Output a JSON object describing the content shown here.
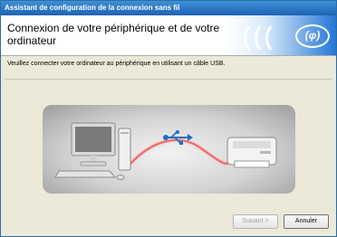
{
  "window": {
    "title": "Assistant de configuration de la connexion sans fil"
  },
  "header": {
    "title": "Connexion de votre périphérique et de votre ordinateur",
    "logo_text": "(φ)"
  },
  "main": {
    "instruction": "Veuillez connecter votre ordinateur au périphérique en utilisant un câble USB."
  },
  "buttons": {
    "next_label": "Suivant >",
    "cancel_label": "Annuler"
  },
  "colors": {
    "accent": "#1e63b4",
    "cable": "#e84c4c",
    "usb_icon": "#1f6fc9"
  },
  "icons": [
    "usb-icon",
    "computer-icon",
    "printer-icon",
    "wireless-logo-icon"
  ]
}
